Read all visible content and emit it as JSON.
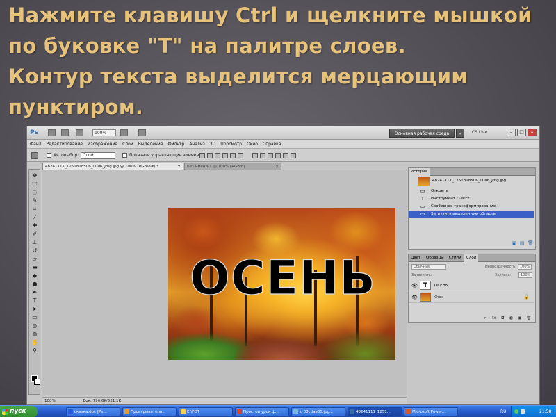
{
  "caption": {
    "line1": "Нажмите клавишу Ctrl и щелкните мышкой",
    "line2": "по буковке \"Т\" на палитре слоев.",
    "line3": "Контур текста выделится мерцающим",
    "line4": "пунктиром."
  },
  "photoshop": {
    "logo": "Ps",
    "zoom": "100%",
    "workspace": "Основная рабочая среда",
    "cs_live": "CS Live",
    "menu": [
      "Файл",
      "Редактирование",
      "Изображение",
      "Слои",
      "Выделение",
      "Фильтр",
      "Анализ",
      "3D",
      "Просмотр",
      "Окно",
      "Справка"
    ],
    "options": {
      "autoselect": "Автовыбор:",
      "autoselect_value": "Слой",
      "show_controls": "Показать управляющие элементы"
    },
    "tabs": {
      "active": "48241111_1251818506_0006_Jmg.jpg @ 100% (RGB/8#) *",
      "inactive": "Без имени-1 @ 100% (RGB/8)",
      "close": "×"
    },
    "canvas_text": "ОСЕНЬ",
    "status": {
      "zoom": "100%",
      "doc": "Док: 796,6K/521,1K"
    }
  },
  "history": {
    "tabs": [
      "История"
    ],
    "snapshot": "48241111_1251818506_0006_Jmg.jpg",
    "items": [
      {
        "icon": "▭",
        "label": "Открыть"
      },
      {
        "icon": "T",
        "label": "Инструмент \"Текст\""
      },
      {
        "icon": "▭",
        "label": "Свободное трансформирование"
      },
      {
        "icon": "▭",
        "label": "Загрузить выделенную область"
      }
    ]
  },
  "layers": {
    "tabs": [
      "Цвет",
      "Образцы",
      "Стили",
      "Слои"
    ],
    "blend": "Обычные",
    "opacity_label": "Непрозрачность:",
    "opacity": "100%",
    "lock_label": "Закрепить:",
    "fill_label": "Заливка:",
    "fill": "100%",
    "rows": [
      {
        "thumb": "T",
        "name": "ОСЕНЬ"
      },
      {
        "thumb": "",
        "name": "Фон"
      }
    ]
  },
  "taskbar": {
    "start": "пуск",
    "items": [
      {
        "label": "сказка.doc [Ре...",
        "color": "#2a5bd7"
      },
      {
        "label": "Проигрыватель...",
        "color": "#e59a2a"
      },
      {
        "label": "E:\\FOT",
        "color": "#f3d05a"
      },
      {
        "label": "Простой урок ф...",
        "color": "#d9412a"
      },
      {
        "label": "z_00cdaa35.jpg...",
        "color": "#7ab5e8"
      },
      {
        "label": "48241111_1251...",
        "color": "#3a6ea8"
      },
      {
        "label": "Microsoft Power...",
        "color": "#d35a2a"
      }
    ],
    "lang": "RU",
    "clock": "21:58"
  },
  "colors": {
    "caption": "#e6c27a",
    "selection": "#3a5fc7"
  }
}
